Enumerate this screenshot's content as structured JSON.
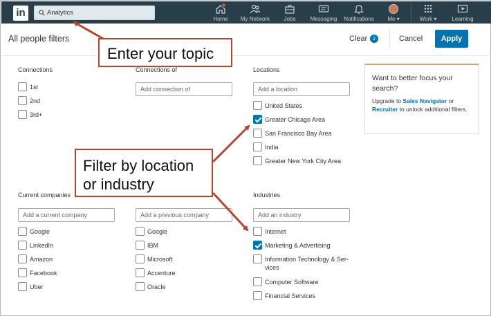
{
  "nav": {
    "logo": "in",
    "search_value": "Analytics",
    "items": [
      {
        "label": "Home",
        "icon": "home-icon"
      },
      {
        "label": "My Network",
        "icon": "network-icon"
      },
      {
        "label": "Jobs",
        "icon": "jobs-icon"
      },
      {
        "label": "Messaging",
        "icon": "messaging-icon"
      },
      {
        "label": "Notifications",
        "icon": "bell-icon"
      },
      {
        "label": "Me ▾",
        "icon": "avatar"
      },
      {
        "label": "Work ▾",
        "icon": "grid-icon"
      },
      {
        "label": "Learning",
        "icon": "play-icon"
      }
    ],
    "colors": {
      "bar": "#283e4a",
      "accent": "#0073b1",
      "badge": "#e0453a"
    }
  },
  "header": {
    "title": "All people filters",
    "clear_label": "Clear",
    "clear_count": "2",
    "cancel_label": "Cancel",
    "apply_label": "Apply"
  },
  "connections": {
    "title": "Connections",
    "options": [
      {
        "label": "1st",
        "checked": false
      },
      {
        "label": "2nd",
        "checked": false
      },
      {
        "label": "3rd+",
        "checked": false
      }
    ]
  },
  "connections_of": {
    "title": "Connections of",
    "placeholder": "Add connection of"
  },
  "locations": {
    "title": "Locations",
    "placeholder": "Add a location",
    "options": [
      {
        "label": "United States",
        "checked": false
      },
      {
        "label": "Greater Chicago Area",
        "checked": true
      },
      {
        "label": "San Francisco Bay Area",
        "checked": false
      },
      {
        "label": "India",
        "checked": false
      },
      {
        "label": "Greater New York City Area",
        "checked": false
      }
    ]
  },
  "current_companies": {
    "title": "Current companies",
    "placeholder": "Add a current company",
    "options": [
      {
        "label": "Google",
        "checked": false
      },
      {
        "label": "LinkedIn",
        "checked": false
      },
      {
        "label": "Amazon",
        "checked": false
      },
      {
        "label": "Facebook",
        "checked": false
      },
      {
        "label": "Uber",
        "checked": false
      }
    ]
  },
  "previous_companies": {
    "placeholder": "Add a previous company",
    "options": [
      {
        "label": "Google",
        "checked": false
      },
      {
        "label": "IBM",
        "checked": false
      },
      {
        "label": "Microsoft",
        "checked": false
      },
      {
        "label": "Accenture",
        "checked": false
      },
      {
        "label": "Oracle",
        "checked": false
      }
    ]
  },
  "industries": {
    "title": "Industries",
    "placeholder": "Add an industry",
    "options": [
      {
        "label": "Internet",
        "checked": false
      },
      {
        "label": "Marketing & Advertising",
        "checked": true
      },
      {
        "label": "Information Technology & Ser-",
        "label2": "vices",
        "checked": false
      },
      {
        "label": "Computer Software",
        "checked": false
      },
      {
        "label": "Financial Services",
        "checked": false
      }
    ]
  },
  "promo": {
    "heading": "Want to better focus your search?",
    "text_1": "Upgrade to ",
    "link_1": "Sales Navigator",
    "text_2": " or ",
    "link_2": "Recruiter",
    "text_3": " to unlock additional filters."
  },
  "annotations": {
    "topic": "Enter your topic",
    "filter_line1": "Filter by location",
    "filter_line2": "or industry",
    "color": "#b5462e"
  }
}
